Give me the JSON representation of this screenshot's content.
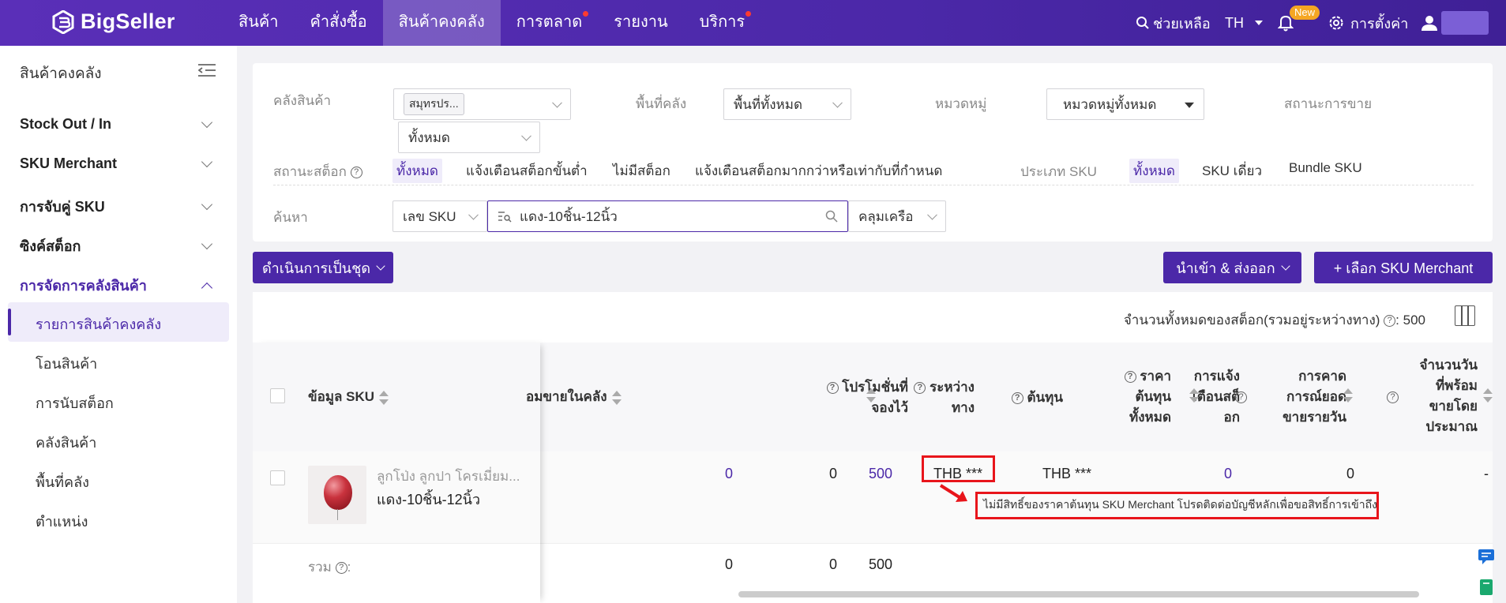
{
  "brand": {
    "name": "BigSeller"
  },
  "nav": {
    "items": [
      "สินค้า",
      "คำสั่งซื้อ",
      "สินค้าคงคลัง",
      "การตลาด",
      "รายงาน",
      "บริการ"
    ],
    "active_index": 2
  },
  "topright": {
    "help": "ช่วยเหลือ",
    "lang": "TH",
    "new_badge": "New",
    "settings": "การตั้งค่า"
  },
  "sidebar": {
    "title": "สินค้าคงคลัง",
    "groups": [
      "Stock Out / In",
      "SKU Merchant",
      "การจับคู่ SKU",
      "ซิงค์สต็อก",
      "การจัดการคลังสินค้า"
    ],
    "items": [
      "รายการสินค้าคงคลัง",
      "โอนสินค้า",
      "การนับสต็อก",
      "คลังสินค้า",
      "พื้นที่คลัง",
      "ตำแหน่ง"
    ]
  },
  "filters": {
    "warehouse_label": "คลังสินค้า",
    "warehouse_tag": "สมุทรปร...",
    "warehouse_second": "ทั้งหมด",
    "area_label": "พื้นที่คลัง",
    "area_value": "พื้นที่ทั้งหมด",
    "category_label": "หมวดหมู่",
    "category_value": "หมวดหมู่ทั้งหมด",
    "sale_status_label": "สถานะการขาย",
    "stock_status_label": "สถานะสต็อก",
    "stock_options": [
      "ทั้งหมด",
      "แจ้งเตือนสต็อกขั้นต่ำ",
      "ไม่มีสต็อก",
      "แจ้งเตือนสต็อกมากกว่าหรือเท่ากับที่กำหนด"
    ],
    "sku_type_label": "ประเภท SKU",
    "sku_type_options": [
      "ทั้งหมด",
      "SKU เดี่ยว",
      "Bundle SKU"
    ],
    "search_label": "ค้นหา",
    "search_field": "เลข SKU",
    "search_value": "แดง-10ชิ้น-12นิ้ว",
    "search_mode": "คลุมเครือ"
  },
  "actions": {
    "batch": "ดำเนินการเป็นชุด",
    "import_export": "นำเข้า & ส่งออก",
    "select_sku": "+ เลือก SKU Merchant"
  },
  "summary": {
    "total_label": "จำนวนทั้งหมดของสต็อก(รวมอยู่ระหว่างทาง)",
    "total_value": "500"
  },
  "table": {
    "headers": {
      "sku_info": "ข้อมูล SKU",
      "sellable": "อมขายในคลัง",
      "promo_1": "โปรโมชั่นที่",
      "promo_2": "จองไว้",
      "transit_1": "ระหว่าง",
      "transit_2": "ทาง",
      "cost": "ต้นทุน",
      "total_cost_1": "ราคา",
      "total_cost_2": "ต้นทุน",
      "total_cost_3": "ทั้งหมด",
      "alert_1": "การแจ้ง",
      "alert_2": "เตือนสต็",
      "alert_3": "อก",
      "forecast_1": "การคาด",
      "forecast_2": "การณ์ยอด",
      "forecast_3": "ขายรายวัน",
      "days_1": "จำนวนวัน",
      "days_2": "ที่พร้อม",
      "days_3": "ขายโดย",
      "days_4": "ประมาณ"
    },
    "row": {
      "title": "ลูกโป่ง ลูกปา โครเมี่ยม...",
      "sku": "แดง-10ชิ้น-12นิ้ว",
      "sellable": "0",
      "promo": "0",
      "transit": "500",
      "cost": "THB ***",
      "total_cost": "THB ***",
      "alert": "0",
      "forecast": "0",
      "days": "-"
    },
    "cost_tooltip": "ไม่มีสิทธิ์ของราคาต้นทุน SKU Merchant โปรดติดต่อบัญชีหลักเพื่อขอสิทธิ์การเข้าถึง",
    "sum": {
      "label": "รวม",
      "sellable": "0",
      "promo": "0",
      "transit": "500"
    }
  },
  "colors": {
    "brand": "#4b28a8",
    "highlight": "#e8151b"
  }
}
